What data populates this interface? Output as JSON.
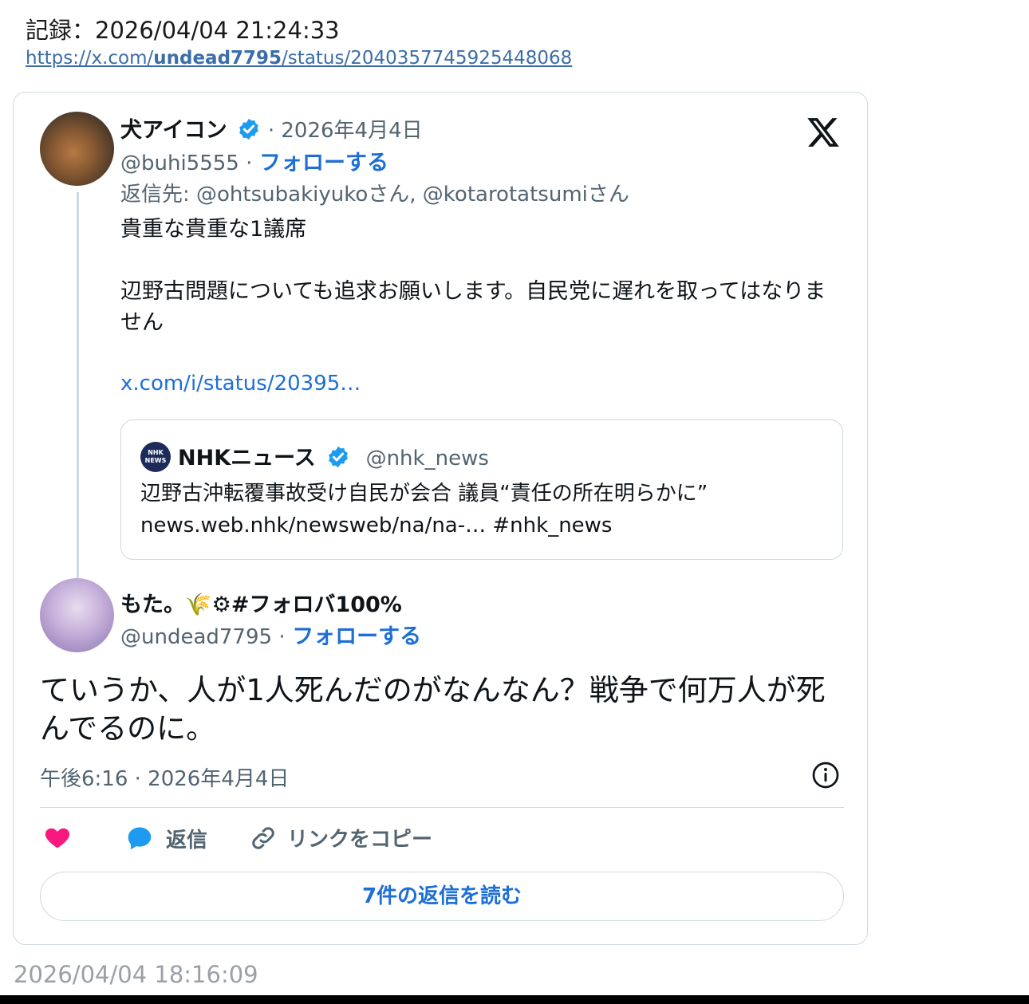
{
  "record": {
    "title": "記録：2026/04/04 21:24:33",
    "url_prefix": "https://x.com/",
    "url_user": "undead7795",
    "url_suffix": "/status/2040357745925448068"
  },
  "post1": {
    "name": "犬アイコン",
    "date": "· 2026年4月4日",
    "handle": "@buhi5555 ·",
    "follow": "フォローする",
    "reply_to": "返信先: @ohtsubakiyukoさん, @kotarotatsumiさん",
    "text_line1": "貴重な貴重な1議席",
    "text_line2": "辺野古問題についても追求お願いします。自民党に遅れを取ってはなりません",
    "link": "x.com/i/status/20395…",
    "quote": {
      "avatar_text": "NHK NEWS",
      "name": "NHKニュース",
      "handle": "@nhk_news",
      "text_line1": "辺野古沖転覆事故受け自民が会合 議員“責任の所在明らかに”",
      "text_line2": "news.web.nhk/newsweb/na/na-… #nhk_news"
    }
  },
  "post2": {
    "name": "もた。🌾⚙#フォロバ100%",
    "handle": "@undead7795 ·",
    "follow": "フォローする",
    "text": "ていうか、人が1人死んだのがなんなん？戦争で何万人が死んでるのに。",
    "time": "午後6:16 · 2026年4月4日"
  },
  "actions": {
    "reply_label": "返信",
    "copy_label": "リンクをコピー",
    "read_replies": "7件の返信を読む"
  },
  "footer_time": "2026/04/04 18:16:09",
  "colors": {
    "accent": "#1d6fd6",
    "verified": "#1d9bf0",
    "like": "#f91880",
    "muted": "#536471"
  },
  "icons": [
    "x-logo-icon",
    "verified-badge-icon",
    "heart-icon",
    "reply-bubble-icon",
    "link-icon",
    "info-icon"
  ]
}
